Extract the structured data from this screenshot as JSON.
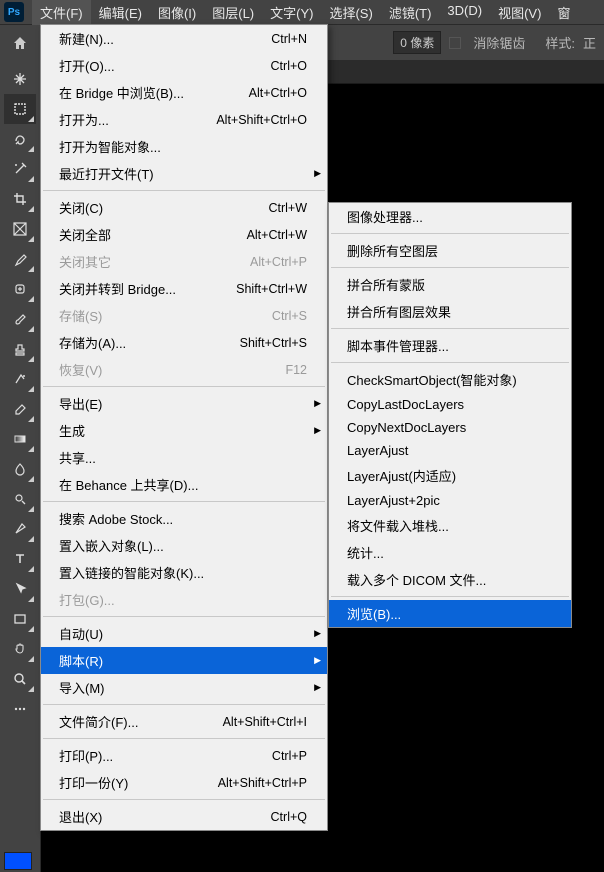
{
  "menubar": {
    "items": [
      "文件(F)",
      "编辑(E)",
      "图像(I)",
      "图层(L)",
      "文字(Y)",
      "选择(S)",
      "滤镜(T)",
      "3D(D)",
      "视图(V)",
      "窗"
    ]
  },
  "options": {
    "pixel_value": "0",
    "pixel_unit": "像素",
    "antialias": "消除锯齿",
    "style": "样式:",
    "style_value": "正"
  },
  "file_menu": [
    {
      "label": "新建(N)...",
      "shortcut": "Ctrl+N"
    },
    {
      "label": "打开(O)...",
      "shortcut": "Ctrl+O"
    },
    {
      "label": "在 Bridge 中浏览(B)...",
      "shortcut": "Alt+Ctrl+O"
    },
    {
      "label": "打开为...",
      "shortcut": "Alt+Shift+Ctrl+O"
    },
    {
      "label": "打开为智能对象..."
    },
    {
      "label": "最近打开文件(T)",
      "submenu": true
    },
    {
      "sep": true
    },
    {
      "label": "关闭(C)",
      "shortcut": "Ctrl+W"
    },
    {
      "label": "关闭全部",
      "shortcut": "Alt+Ctrl+W"
    },
    {
      "label": "关闭其它",
      "shortcut": "Alt+Ctrl+P",
      "disabled": true
    },
    {
      "label": "关闭并转到 Bridge...",
      "shortcut": "Shift+Ctrl+W"
    },
    {
      "label": "存储(S)",
      "shortcut": "Ctrl+S",
      "disabled": true
    },
    {
      "label": "存储为(A)...",
      "shortcut": "Shift+Ctrl+S"
    },
    {
      "label": "恢复(V)",
      "shortcut": "F12",
      "disabled": true
    },
    {
      "sep": true
    },
    {
      "label": "导出(E)",
      "submenu": true
    },
    {
      "label": "生成",
      "submenu": true
    },
    {
      "label": "共享..."
    },
    {
      "label": "在 Behance 上共享(D)..."
    },
    {
      "sep": true
    },
    {
      "label": "搜索 Adobe Stock..."
    },
    {
      "label": "置入嵌入对象(L)..."
    },
    {
      "label": "置入链接的智能对象(K)..."
    },
    {
      "label": "打包(G)...",
      "disabled": true
    },
    {
      "sep": true
    },
    {
      "label": "自动(U)",
      "submenu": true
    },
    {
      "label": "脚本(R)",
      "submenu": true,
      "highlighted": true
    },
    {
      "label": "导入(M)",
      "submenu": true
    },
    {
      "sep": true
    },
    {
      "label": "文件简介(F)...",
      "shortcut": "Alt+Shift+Ctrl+I"
    },
    {
      "sep": true
    },
    {
      "label": "打印(P)...",
      "shortcut": "Ctrl+P"
    },
    {
      "label": "打印一份(Y)",
      "shortcut": "Alt+Shift+Ctrl+P"
    },
    {
      "sep": true
    },
    {
      "label": "退出(X)",
      "shortcut": "Ctrl+Q"
    }
  ],
  "submenu": [
    {
      "label": "图像处理器..."
    },
    {
      "sep": true
    },
    {
      "label": "删除所有空图层"
    },
    {
      "sep": true
    },
    {
      "label": "拼合所有蒙版"
    },
    {
      "label": "拼合所有图层效果"
    },
    {
      "sep": true
    },
    {
      "label": "脚本事件管理器..."
    },
    {
      "sep": true
    },
    {
      "label": "CheckSmartObject(智能对象)"
    },
    {
      "label": "CopyLastDocLayers"
    },
    {
      "label": "CopyNextDocLayers"
    },
    {
      "label": "LayerAjust"
    },
    {
      "label": "LayerAjust(内适应)"
    },
    {
      "label": "LayerAjust+2pic"
    },
    {
      "label": "将文件载入堆栈..."
    },
    {
      "label": "统计..."
    },
    {
      "label": "载入多个 DICOM 文件..."
    },
    {
      "sep": true
    },
    {
      "label": "浏览(B)...",
      "highlighted": true
    }
  ],
  "tools": [
    "move",
    "marquee",
    "lasso",
    "wand",
    "crop",
    "frame",
    "eyedropper",
    "heal",
    "brush",
    "stamp",
    "history",
    "eraser",
    "gradient",
    "blur",
    "dodge",
    "pen",
    "type",
    "path-select",
    "rectangle",
    "hand",
    "zoom",
    "more"
  ]
}
